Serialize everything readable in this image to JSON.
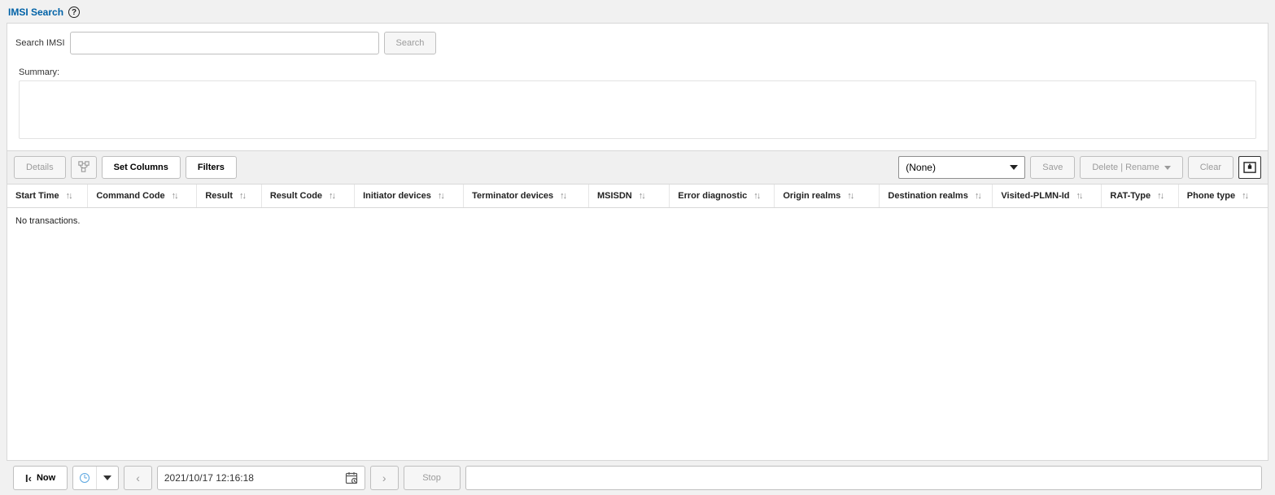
{
  "header": {
    "title": "IMSI Search"
  },
  "search": {
    "label": "Search IMSI",
    "value": "",
    "button": "Search"
  },
  "summary": {
    "label": "Summary:"
  },
  "toolbar": {
    "details": "Details",
    "set_columns": "Set Columns",
    "filters": "Filters",
    "select_value": "(None)",
    "save": "Save",
    "delete_rename": "Delete | Rename",
    "clear": "Clear"
  },
  "columns": [
    "Start Time",
    "Command Code",
    "Result",
    "Result Code",
    "Initiator devices",
    "Terminator devices",
    "MSISDN",
    "Error diagnostic",
    "Origin realms",
    "Destination realms",
    "Visited-PLMN-Id",
    "RAT-Type",
    "Phone type"
  ],
  "table": {
    "empty_message": "No transactions."
  },
  "footer": {
    "now": "Now",
    "datetime": "2021/10/17 12:16:18",
    "stop": "Stop"
  }
}
